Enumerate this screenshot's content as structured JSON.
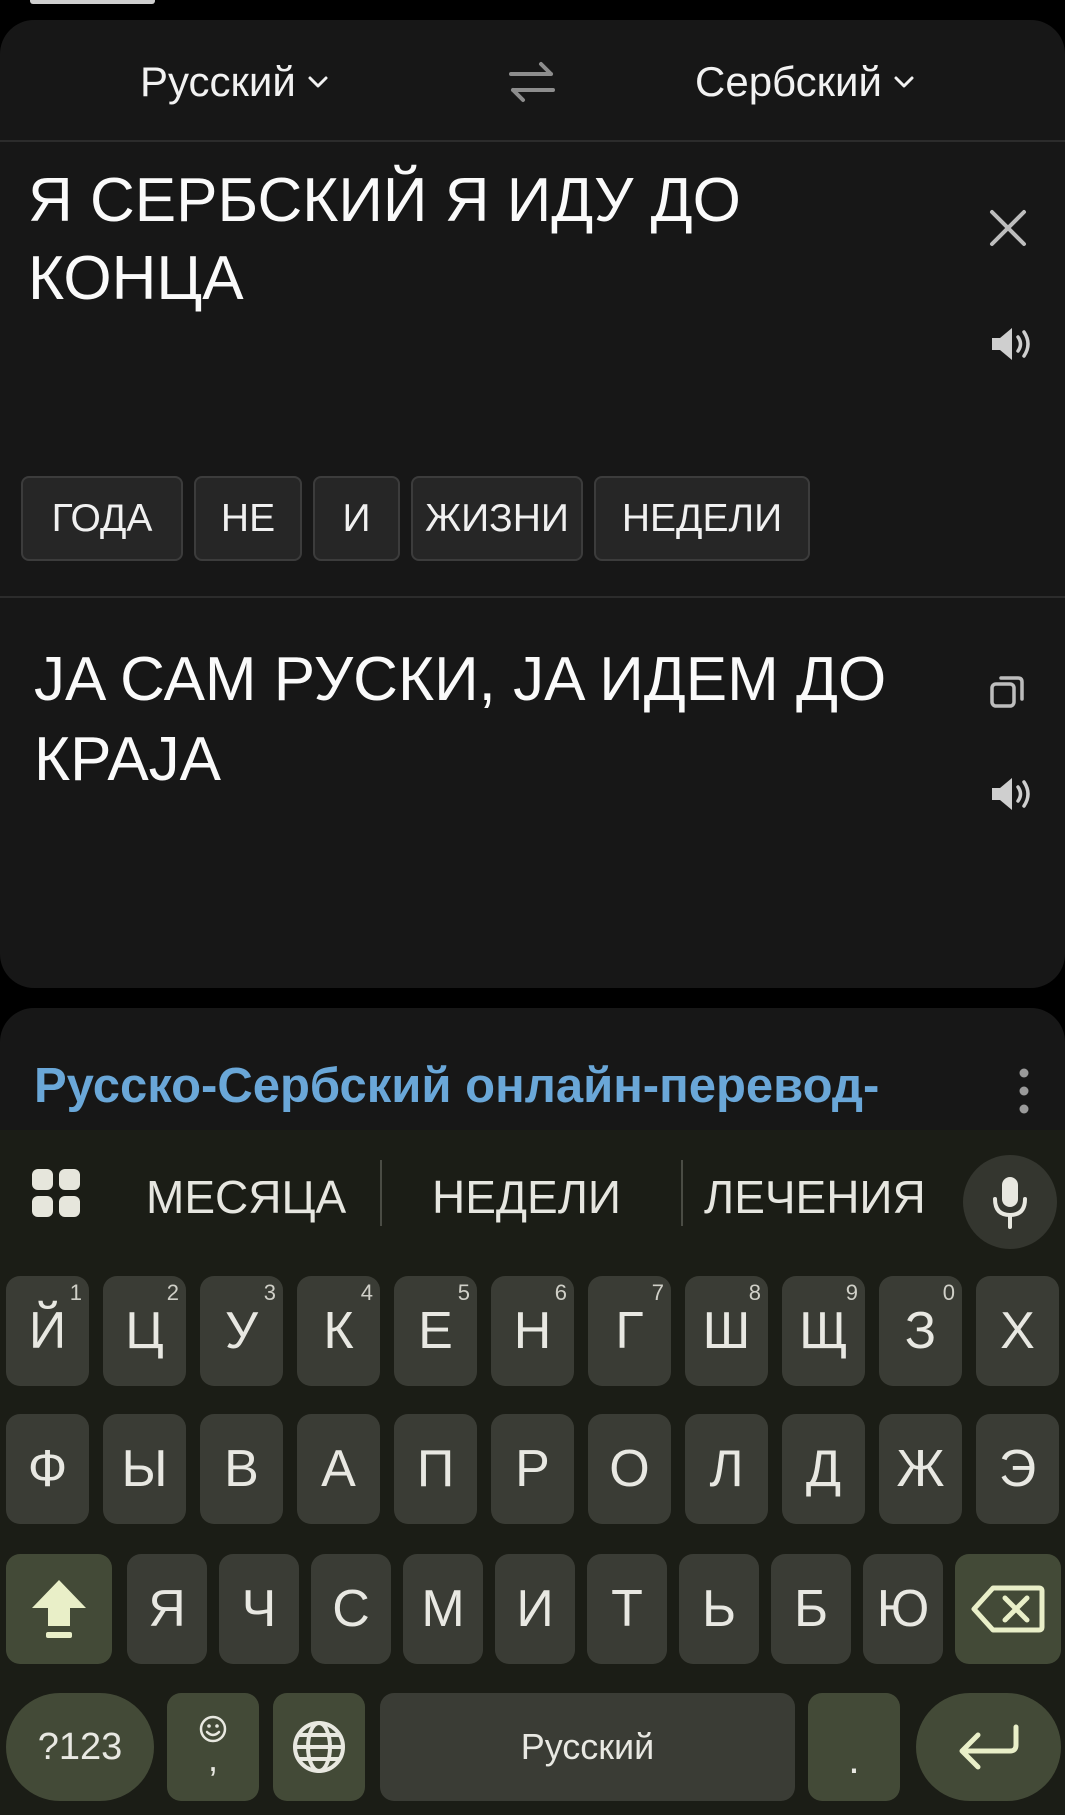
{
  "header": {
    "source_lang": "Русский",
    "target_lang": "Сербский"
  },
  "source": {
    "text": "Я СЕРБСКИЙ Я ИДУ ДО КОНЦА"
  },
  "suggestion_chips": [
    "ГОДА",
    "НЕ",
    "И",
    "ЖИЗНИ",
    "НЕДЕЛИ"
  ],
  "translation": {
    "text": "JA САМ РУСКИ, JA ИДЕМ ДО КРАJA"
  },
  "ad": {
    "title": "Русско-Сербский онлайн-перевод-"
  },
  "keyboard": {
    "suggestions": [
      "МЕСЯЦА",
      "НЕДЕЛИ",
      "ЛЕЧЕНИЯ"
    ],
    "row1": [
      "Й",
      "Ц",
      "У",
      "К",
      "Е",
      "Н",
      "Г",
      "Ш",
      "Щ",
      "З",
      "Х"
    ],
    "row1_hints": [
      "1",
      "2",
      "3",
      "4",
      "5",
      "6",
      "7",
      "8",
      "9",
      "0",
      ""
    ],
    "row2": [
      "Ф",
      "Ы",
      "В",
      "А",
      "П",
      "Р",
      "О",
      "Л",
      "Д",
      "Ж",
      "Э"
    ],
    "row3": [
      "Я",
      "Ч",
      "С",
      "М",
      "И",
      "Т",
      "Ь",
      "Б",
      "Ю"
    ],
    "symbols_label": "?123",
    "comma_label": ",",
    "space_label": "Русский",
    "period_label": "."
  },
  "icons": {
    "chevron": "chevron-down-icon",
    "swap": "swap-icon",
    "clear": "close-icon",
    "speaker": "speaker-icon",
    "copy": "copy-icon",
    "more": "more-vertical-icon",
    "grid": "apps-grid-icon",
    "mic": "microphone-icon",
    "shift": "shift-icon",
    "backspace": "backspace-icon",
    "emoji": "emoji-icon",
    "globe": "globe-icon",
    "enter": "enter-icon"
  },
  "colors": {
    "background": "#000000",
    "card": "#171717",
    "ad_title": "#6aa7d8",
    "keyboard_bg": "#1b1d16",
    "key_bg": "#3a3c35",
    "func_key_bg": "#434a37"
  }
}
